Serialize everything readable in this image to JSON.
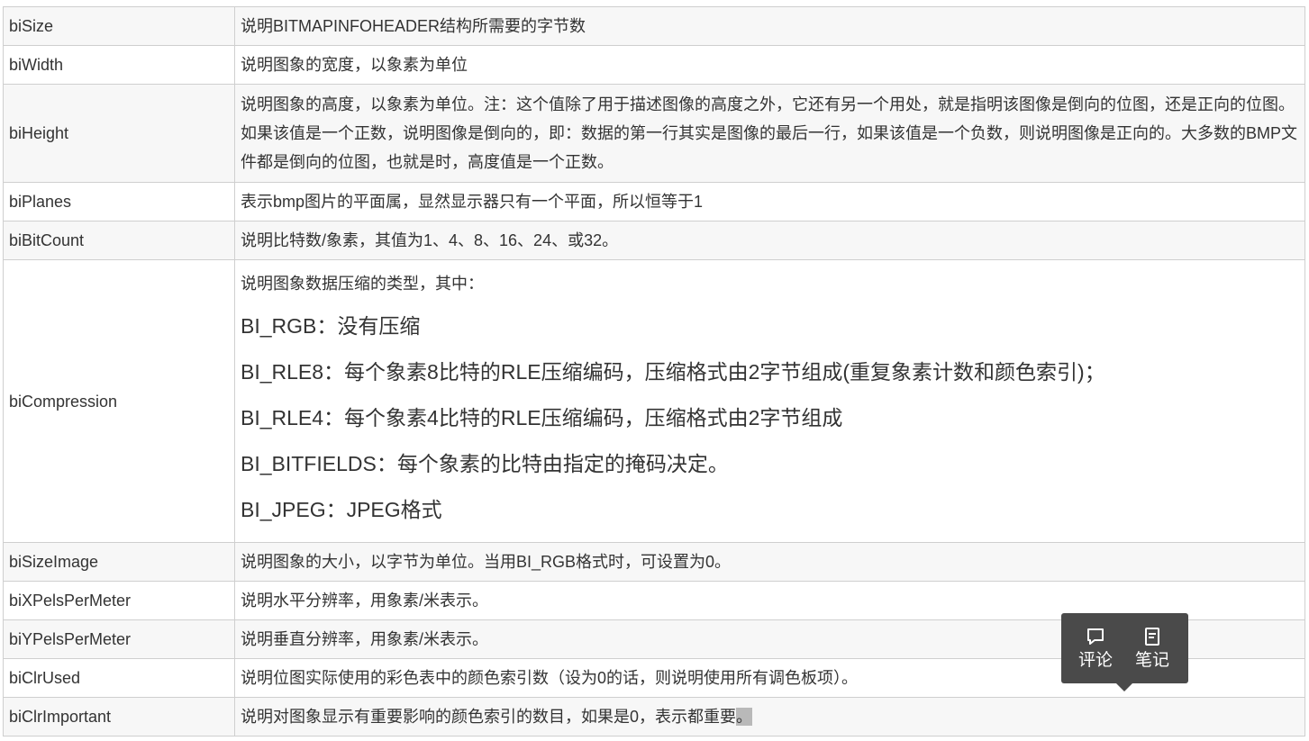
{
  "rows": [
    {
      "field": "biSize",
      "desc": "说明BITMAPINFOHEADER结构所需要的字节数"
    },
    {
      "field": "biWidth",
      "desc": "说明图象的宽度，以象素为单位"
    },
    {
      "field": "biHeight",
      "desc": "说明图象的高度，以象素为单位。注：这个值除了用于描述图像的高度之外，它还有另一个用处，就是指明该图像是倒向的位图，还是正向的位图。如果该值是一个正数，说明图像是倒向的，即：数据的第一行其实是图像的最后一行，如果该值是一个负数，则说明图像是正向的。大多数的BMP文件都是倒向的位图，也就是时，高度值是一个正数。"
    },
    {
      "field": "biPlanes",
      "desc": "表示bmp图片的平面属，显然显示器只有一个平面，所以恒等于1"
    },
    {
      "field": "biBitCount",
      "desc": "说明比特数/象素，其值为1、4、8、16、24、或32。"
    },
    {
      "field": "biCompression",
      "desc": "说明图象数据压缩的类型，其中：",
      "types": [
        "BI_RGB：没有压缩",
        "BI_RLE8：每个象素8比特的RLE压缩编码，压缩格式由2字节组成(重复象素计数和颜色索引)；",
        "BI_RLE4：每个象素4比特的RLE压缩编码，压缩格式由2字节组成",
        "BI_BITFIELDS：每个象素的比特由指定的掩码决定。",
        "BI_JPEG：JPEG格式"
      ]
    },
    {
      "field": "biSizeImage",
      "desc": "说明图象的大小，以字节为单位。当用BI_RGB格式时，可设置为0。"
    },
    {
      "field": "biXPelsPerMeter",
      "desc": "说明水平分辨率，用象素/米表示。"
    },
    {
      "field": "biYPelsPerMeter",
      "desc": "说明垂直分辨率，用象素/米表示。"
    },
    {
      "field": "biClrUsed",
      "desc": "说明位图实际使用的彩色表中的颜色索引数（设为0的话，则说明使用所有调色板项）。"
    },
    {
      "field": "biClrImportant",
      "desc": "说明对图象显示有重要影响的颜色索引的数目，如果是0，表示都重要",
      "desc_selected_end": "。"
    }
  ],
  "popup": {
    "comment_label": "评论",
    "note_label": "笔记",
    "comment_icon": "comment-icon",
    "note_icon": "note-icon"
  },
  "colors": {
    "border": "#cfcfcf",
    "stripe": "#f7f7f7",
    "text": "#333333",
    "popup_bg": "#4a4a4a",
    "selection": "#b9b9b9"
  }
}
